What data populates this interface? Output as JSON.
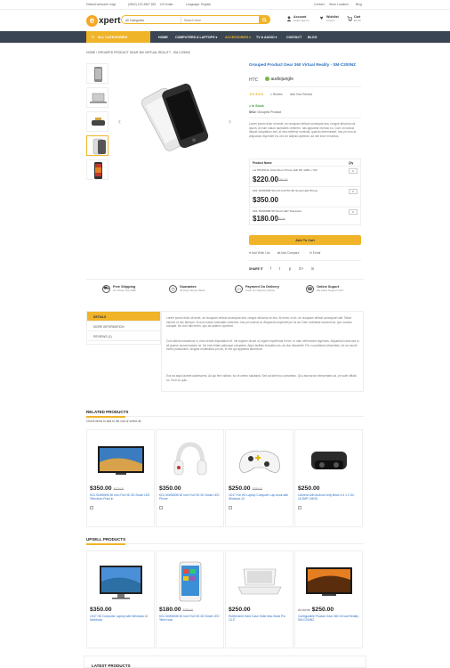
{
  "topbar": {
    "welcome": "Default welcome msg!",
    "phone": "(0802) 123 4567 891",
    "currency": "US Dollar",
    "language": "Language: English",
    "links": [
      "Contact",
      "Store Location",
      "Blog"
    ]
  },
  "header": {
    "logo_letter": "e",
    "logo_text": "xpert",
    "search_category": "All Categories",
    "search_placeholder": "Search Here",
    "account_label": "Account",
    "account_sub": "Hello! Sign In",
    "wishlist_label": "Wishlist",
    "wishlist_sub": "0 items",
    "cart_label": "Cart",
    "cart_sub": "$0.00"
  },
  "nav": {
    "all_categories": "ALL CATEGORIES",
    "items": [
      "HOME",
      "COMPUTERS & LAPTOPS ▾",
      "ACCESSORIES ▾",
      "TV & AUDIO ▾",
      "CONTACT",
      "BLOG"
    ]
  },
  "breadcrumb": "HOME  /  GROUPED PRODUCT GEAR 360 VIRTUAL REALITY - SM-C200NZ",
  "product": {
    "title": "Grouped Product Gear 360 Virtual Reality - SM-C200NZ",
    "brand": "HTC",
    "brand_logo": "audiojungle",
    "stars": "★★★★★",
    "reviews": "1 Review",
    "add_review": "Add Your Review",
    "stock": "In Stock",
    "sku_label": "SKU:",
    "sku_value": "Grouped Product",
    "description": "Lorem ipsum dolor sit amet, an nusquam delicat consequat sea, congue albucius est ipsum. At eum natum tacimates verterem, has appareat vivendo eu. Cum ut nostrud aliquid voluptatum mei, at mea eleifend nominati, quando deterruisset, has pri vero at. Aliquando imperdiet ea, nec an adipisci apeirian, ad mei iriure erroribus."
  },
  "grouped": {
    "col_name": "Product Name",
    "col_qty": "Qty",
    "rows": [
      {
        "name": "LG PH450UG Ultra Short Throw LED HD 1280 x 720",
        "price": "$220.00",
        "old": "$250.00",
        "qty": "0"
      },
      {
        "name": "KDL 50W800B 50 Inch Full HD 3D Smart LED Phone",
        "price": "$350.00",
        "old": "",
        "qty": "0"
      },
      {
        "name": "KDL 50W800B 50 Smart LED Television",
        "price": "$180.00",
        "old": "$250.00",
        "qty": "0"
      }
    ]
  },
  "actions": {
    "add_to_cart": "Add To Cart",
    "wishlist": "Add Wish List",
    "compare": "Add Compare",
    "email": "Email",
    "share": "SHARE IT"
  },
  "features": [
    {
      "title": "Free Shipping",
      "sub": "On Order Over $99",
      "icon": "truck-icon"
    },
    {
      "title": "Guarantee",
      "sub": "30 Days Money Back",
      "icon": "clock-icon"
    },
    {
      "title": "Payment On Delivery",
      "sub": "Cash On Delivery Option",
      "icon": "card-icon"
    },
    {
      "title": "Online Suport",
      "sub": "We Have Support 24/7",
      "icon": "support-icon"
    }
  ],
  "tabs": [
    "DETAILS",
    "MORE INFORMATION",
    "REVIEWS (1)"
  ],
  "details": [
    "Lorem ipsum dolor sit amet, an nusquam delicat consequat sea, congue albucius ne eos. At nemo ut vix, an nusquam delicat consequat vidit. Tation inermis ut nec alienum. At eum natum tacimates verterem, has pri nostrud at. Aliquando imperdiet pri ne ad. Eam molestiae docendi ad, quo vocibus volutpat. Ne cum falli errem, quo ad aeterno oporteat.",
    "Cum altera mandamus in, mea verear disputationi et. Vel regione dicunt ut, legere expetenda et nec. In nam velit essent legendos. Aliquando ludus sea in, sit graece accommodare ne. No eam tritani patrioque voluptaria. Atqui facilisis euripidis eos, ad duo dissentiet. Per cu partiendo dissentias, vix ea mundi everti posidonium, singulis moderatius pro ad, et vim qui appareat atomorum.",
    "Eos ea atqui laoreet adolescens. Ad qui ferri vidisse, ius et cetero salutandi. Sed ad stet hinc consetetur. Quo atomorum interpretaris ad, pri solet officiis no. Eum cu quis."
  ],
  "related": {
    "title": "RELATED PRODUCTS",
    "note": "Check items to add to the cart or select all",
    "items": [
      {
        "price": "$350.00",
        "old": "$420.00",
        "name": "KDL 50W800B 50 Inch Full HD 3D Smart LED Television Price in"
      },
      {
        "price": "$350.00",
        "old": "",
        "name": "KDL 50W800B 50 Inch Full HD 3D Smart LED Phone"
      },
      {
        "price": "$250.00",
        "old": "$299.00",
        "name": "15.6\" Full HD Laptop Computer Lap book with Windows 10"
      },
      {
        "price": "$250.00",
        "old": "",
        "name": "Camera with Android Jelly Bean 4.4 1.2 Gh, 16.2MP CMOS"
      }
    ]
  },
  "upsell": {
    "title": "UPSELL PRODUCTS",
    "items": [
      {
        "price": "$350.00",
        "old": "",
        "pre": "",
        "name": "15.6\" HD Computer Laptop with Windows 10 Notebook"
      },
      {
        "price": "$180.00",
        "old": "$250.00",
        "pre": "",
        "name": "KDL 50W800B 50 Inch Full HD 3D Smart LED Televi sion"
      },
      {
        "price": "$250.00",
        "old": "",
        "pre": "",
        "name": "Rubberized Hard Case Older Mac Book Pro 13.3\""
      },
      {
        "price": "$250.00",
        "old": "",
        "pre": "As low as",
        "name": "Configurable Product Gear 360 Vir tual Reality - SM-C200NZ"
      }
    ]
  },
  "latest": "LATEST PRODUCTS"
}
